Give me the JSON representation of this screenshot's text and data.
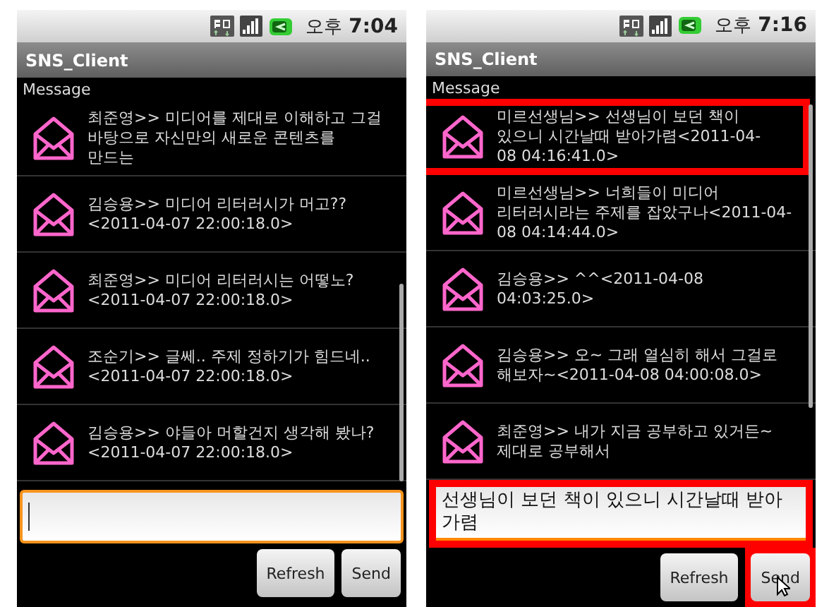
{
  "screens": [
    {
      "status_bar": {
        "period": "오후",
        "time": "7:04"
      },
      "app_title": "SNS_Client",
      "list_label": "Message",
      "messages": [
        {
          "text": "최준영>> 미디어를 제대로 이해하고 그걸 바탕으로 자신만의 새로운 콘텐츠를 만드는",
          "highlighted": false
        },
        {
          "text": "김승용>> 미디어 리터러시가 머고??<2011-04-07 22:00:18.0>",
          "highlighted": false
        },
        {
          "text": "최준영>> 미디어 리터러시는 어떻노?<2011-04-07 22:00:18.0>",
          "highlighted": false
        },
        {
          "text": "조순기>> 글쎄.. 주제 정하기가 힘드네.. <2011-04-07 22:00:18.0>",
          "highlighted": false
        },
        {
          "text": "김승용>> 야들아 머할건지 생각해 봤나?<2011-04-07 22:00:18.0>",
          "highlighted": false
        }
      ],
      "input": {
        "focused": true,
        "highlighted": false
      },
      "buttons": [
        {
          "label": "Refresh",
          "highlighted": false,
          "pointer": false
        },
        {
          "label": "Send",
          "highlighted": false,
          "pointer": false
        }
      ]
    },
    {
      "status_bar": {
        "period": "오후",
        "time": "7:16"
      },
      "app_title": "SNS_Client",
      "list_label": "Message",
      "messages": [
        {
          "text": "미르선생님>> 선생님이 보던 책이 있으니 시간날때 받아가렴<2011-04-08 04:16:41.0>",
          "highlighted": true
        },
        {
          "text": "미르선생님>> 너희들이 미디어 리터러시라는 주제를 잡았구나<2011-04-08 04:14:44.0>",
          "highlighted": false
        },
        {
          "text": "김승용>> ^^<2011-04-08 04:03:25.0>",
          "highlighted": false
        },
        {
          "text": "김승용>> 오~ 그래 열심히 해서 그걸로 해보자~<2011-04-08 04:00:08.0>",
          "highlighted": false
        },
        {
          "text": "최준영>> 내가 지금 공부하고 있거든~ 제대로 공부해서",
          "highlighted": false
        }
      ],
      "input": {
        "value": "선생님이 보던 책이 있으니 시간날때 받아가렴",
        "focused": false,
        "highlighted": true
      },
      "buttons": [
        {
          "label": "Refresh",
          "highlighted": false,
          "pointer": false
        },
        {
          "label": "Send",
          "highlighted": true,
          "pointer": true
        }
      ]
    }
  ]
}
